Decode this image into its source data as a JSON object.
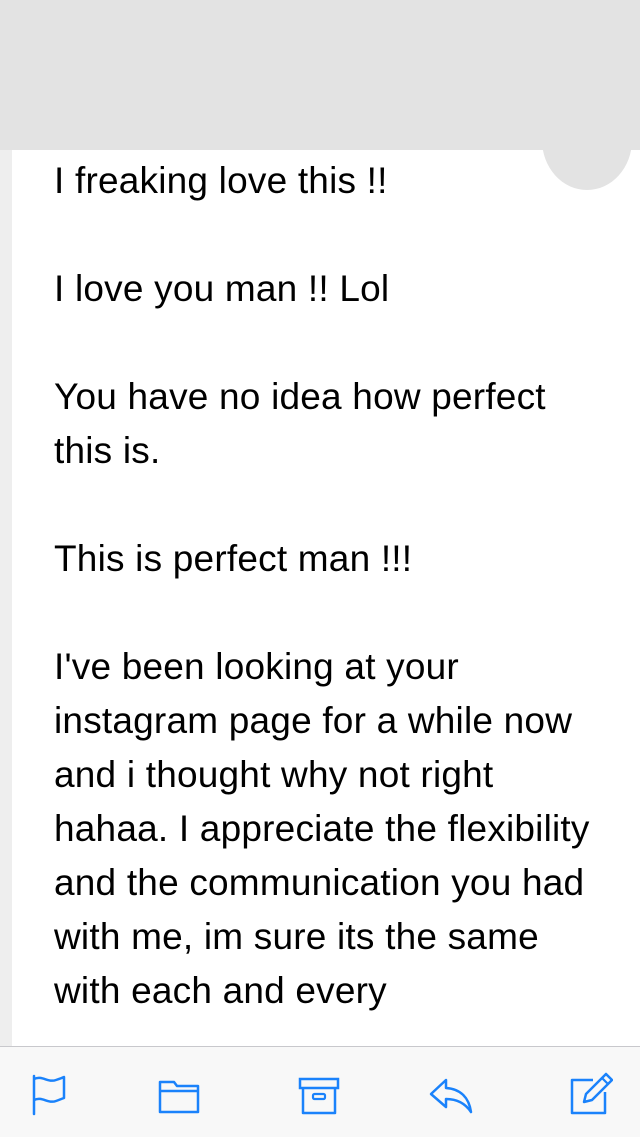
{
  "message": {
    "paragraphs": [
      "I freaking love this !!",
      "I love you man !! Lol",
      "You have no idea how perfect this is.",
      "This is perfect man !!!",
      "I've been looking at your instagram page for a while now and i thought why not right hahaa. I appreciate the flexibility and the communication you had with me, im sure its the same with each and every"
    ]
  },
  "toolbar": {
    "icons": [
      "flag-icon",
      "folder-icon",
      "archive-icon",
      "reply-icon",
      "compose-icon"
    ]
  },
  "colors": {
    "accent": "#1a82fb",
    "redaction": "#e3e3e3",
    "text": "#000000",
    "toolbar_bg": "#f8f8f8"
  }
}
